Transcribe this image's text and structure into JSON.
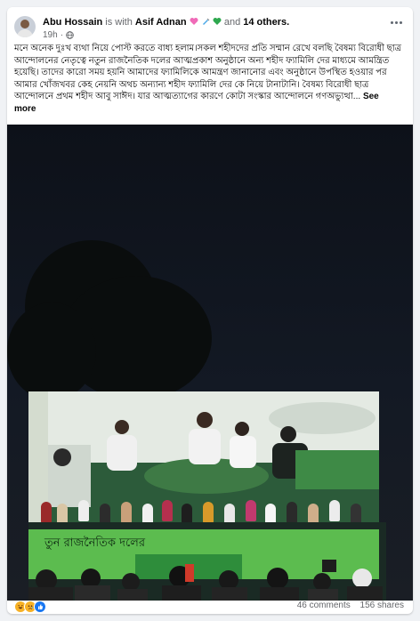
{
  "post": {
    "author": "Abu Hossain",
    "with_text": "is with",
    "tagged": "Asif Adnan",
    "and_text": "and",
    "others": "14 others.",
    "time": "19h",
    "text": "মনে অনেক দুঃখ ব্যথা নিয়ে পোস্ট করতে বাধ্য হলাম।সকল শহীদদের প্রতি সম্মান রেখে বলছি বৈষম্য বিরোধী ছাত্র আন্দোলনের নেতৃত্বে নতুন রাজনৈতিক দলের আত্মপ্রকাশ অনুষ্ঠানে অন্য শহীদ ফ্যামিলি দের মাধ্যমে আমন্ত্রিত হয়েছি। তাদের কারো সময় হয়নি আমাদের ফ্যামিলিকে আমন্ত্রণ জানানোর এবং অনুষ্ঠানে উপস্থিত হওয়ার পর আমার খোঁজখবর কেহ নেয়নি অথচ অন্যান্য শহীদ ফ্যামিলি দের কে নিয়ে টানাটানি। বৈষম্য বিরোধী ছাত্র আন্দোলনে প্রথম শহীদ আবু সাঈদ। যার আত্মত্যাগের কারণে কোটা সংস্কার আন্দোলনে গণঅভ্যুত্থা...",
    "see_more": "See more"
  },
  "photo": {
    "banner_text": "তুন রাজনৈতিক দলের"
  },
  "footer": {
    "reaction_icons": [
      "haha-icon",
      "sad-icon",
      "like-icon"
    ],
    "comments": "46 comments",
    "shares": "156 shares"
  },
  "colors": {
    "text": "#050505",
    "muted": "#65676b",
    "like_blue": "#1877f2",
    "reaction_yellow": "#f7b125",
    "banner_green": "#5cbc4f"
  }
}
